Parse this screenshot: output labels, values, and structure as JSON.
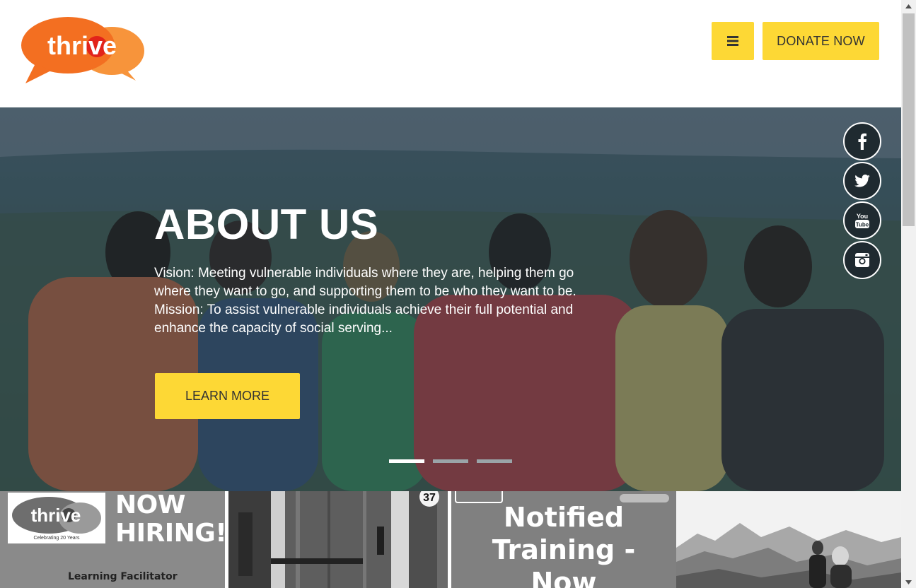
{
  "header": {
    "logo_text": "thrive",
    "donate_label": "DONATE NOW",
    "menu_icon": "hamburger-icon"
  },
  "hero": {
    "title": "ABOUT US",
    "text": "Vision: Meeting vulnerable individuals where they are, helping them go where they want to go, and supporting them to be who they want to be. Mission: To assist vulnerable individuals achieve their full potential and enhance the capacity of social serving...",
    "button_label": "LEARN MORE",
    "slides_count": 3,
    "active_slide": 1
  },
  "social": [
    "facebook-icon",
    "twitter-icon",
    "youtube-icon",
    "instagram-icon"
  ],
  "tiles": {
    "hiring": {
      "logo_text": "thrive",
      "logo_tagline": "Celebrating 20 Years",
      "headline_line1": "NOW",
      "headline_line2": "HIRING!",
      "subtitle": "Learning Facilitator"
    },
    "door": {
      "number": "37"
    },
    "training": {
      "line1": "Notified",
      "line2": "Training -",
      "line3": "Now"
    }
  },
  "colors": {
    "accent": "#fdd835",
    "logo_orange": "#f36f21",
    "logo_red": "#e2231a",
    "hero_overlay": "#2c3d47"
  }
}
